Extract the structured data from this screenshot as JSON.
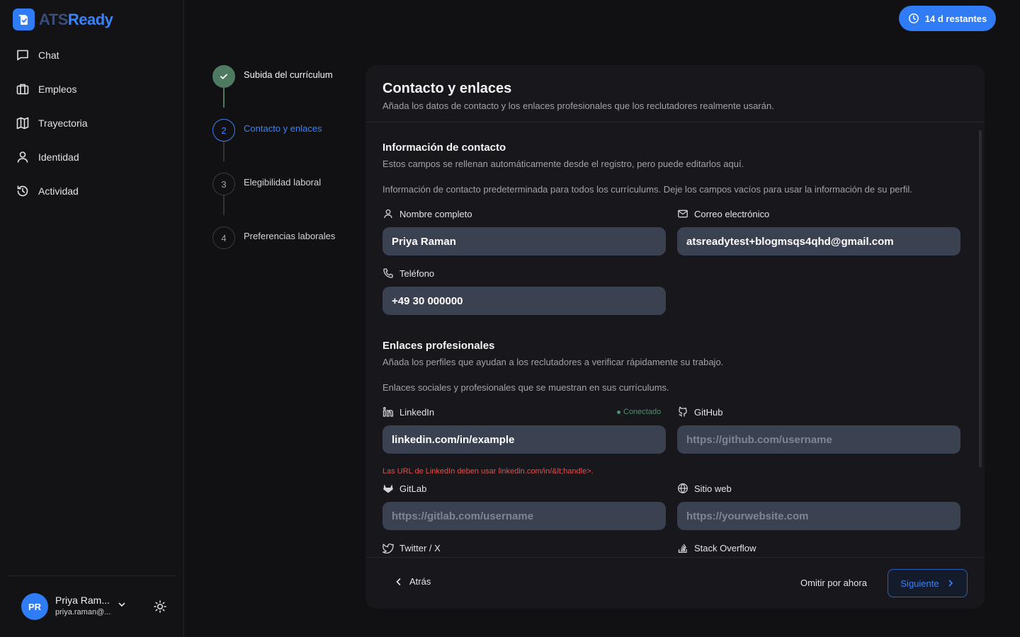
{
  "brand": {
    "name_part1": "ATS",
    "name_part2": "Ready"
  },
  "nav": {
    "items": [
      {
        "label": "Chat",
        "icon": "chat-icon"
      },
      {
        "label": "Empleos",
        "icon": "briefcase-icon"
      },
      {
        "label": "Trayectoria",
        "icon": "map-icon"
      },
      {
        "label": "Identidad",
        "icon": "user-icon"
      },
      {
        "label": "Actividad",
        "icon": "history-icon"
      }
    ]
  },
  "user": {
    "initials": "PR",
    "name": "Priya Ram...",
    "email": "priya.raman@..."
  },
  "trial": {
    "label": "14 d restantes"
  },
  "steps": [
    {
      "number": "1",
      "label": "Subida del currículum",
      "status": "done"
    },
    {
      "number": "2",
      "label": "Contacto y enlaces",
      "status": "active"
    },
    {
      "number": "3",
      "label": "Elegibilidad laboral",
      "status": "pending"
    },
    {
      "number": "4",
      "label": "Preferencias laborales",
      "status": "pending"
    }
  ],
  "card": {
    "title": "Contacto y enlaces",
    "subtitle": "Añada los datos de contacto y los enlaces profesionales que los reclutadores realmente usarán."
  },
  "contact": {
    "title": "Información de contacto",
    "desc": "Estos campos se rellenan automáticamente desde el registro, pero puede editarlos aquí.",
    "note": "Información de contacto predeterminada para todos los currículums. Deje los campos vacíos para usar la información de su perfil.",
    "name_label": "Nombre completo",
    "name_value": "Priya Raman",
    "email_label": "Correo electrónico",
    "email_value": "atsreadytest+blogmsqs4qhd@gmail.com",
    "phone_label": "Teléfono",
    "phone_value": "+49 30 000000"
  },
  "links": {
    "title": "Enlaces profesionales",
    "desc": "Añada los perfiles que ayudan a los reclutadores a verificar rápidamente su trabajo.",
    "note": "Enlaces sociales y profesionales que se muestran en sus currículums.",
    "linkedin_label": "LinkedIn",
    "linkedin_status": "Conectado",
    "linkedin_value": "linkedin.com/in/example",
    "linkedin_error": "Las URL de LinkedIn deben usar linkedin.com/in/&lt;handle>.",
    "github_label": "GitHub",
    "github_placeholder": "https://github.com/username",
    "gitlab_label": "GitLab",
    "gitlab_placeholder": "https://gitlab.com/username",
    "website_label": "Sitio web",
    "website_placeholder": "https://yourwebsite.com",
    "twitter_label": "Twitter / X",
    "stackoverflow_label": "Stack Overflow"
  },
  "footer": {
    "back": "Atrás",
    "skip": "Omitir por ahora",
    "next": "Siguiente"
  },
  "colors": {
    "accent": "#2f7cf6",
    "done": "#4f7a62",
    "error": "#e0504d"
  }
}
